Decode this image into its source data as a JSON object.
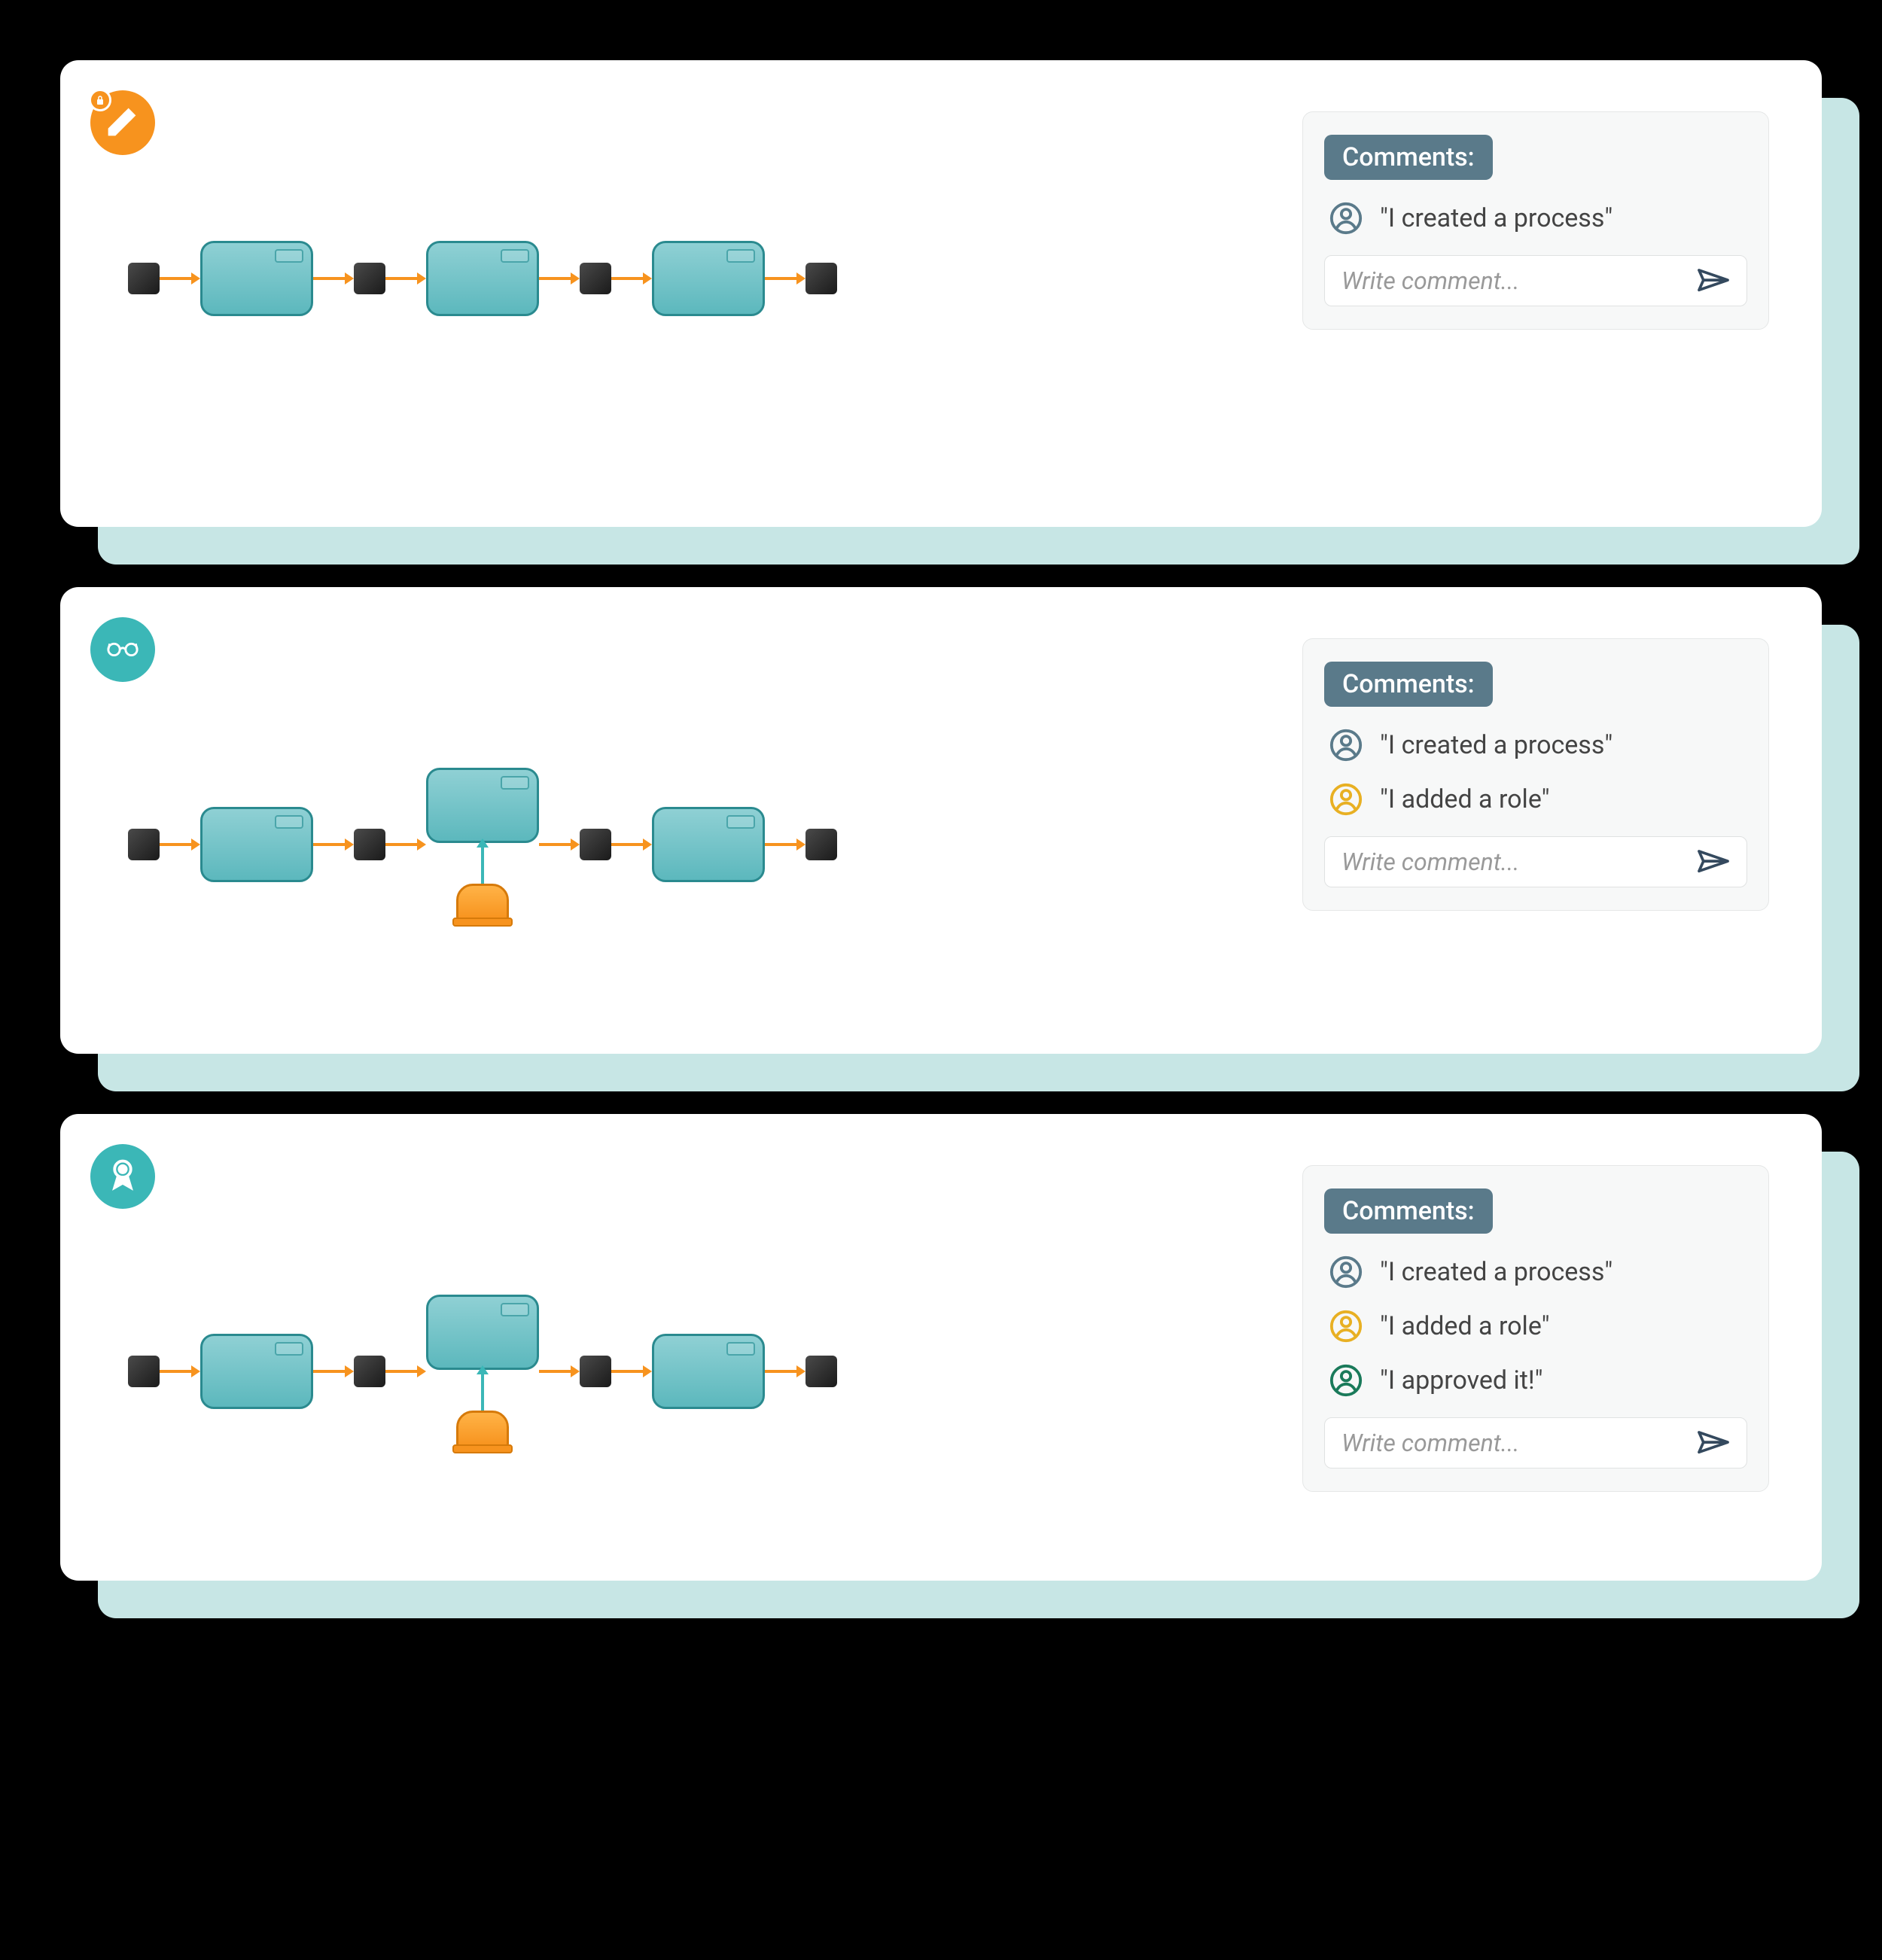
{
  "stages": [
    {
      "badge": {
        "color": "orange",
        "icon": "pencil",
        "lock": true
      },
      "flow": {
        "hasRole": false
      },
      "comments": {
        "header": "Comments:",
        "items": [
          {
            "avatarColor": "#5a7a8a",
            "text": "\"I created a process\""
          }
        ],
        "placeholder": "Write comment..."
      }
    },
    {
      "badge": {
        "color": "teal",
        "icon": "glasses",
        "lock": false
      },
      "flow": {
        "hasRole": true
      },
      "comments": {
        "header": "Comments:",
        "items": [
          {
            "avatarColor": "#5a7a8a",
            "text": "\"I created a process\""
          },
          {
            "avatarColor": "#e8b023",
            "text": "\"I added a role\""
          }
        ],
        "placeholder": "Write comment..."
      }
    },
    {
      "badge": {
        "color": "teal",
        "icon": "ribbon",
        "lock": false
      },
      "flow": {
        "hasRole": true
      },
      "comments": {
        "header": "Comments:",
        "items": [
          {
            "avatarColor": "#5a7a8a",
            "text": "\"I created a process\""
          },
          {
            "avatarColor": "#e8b023",
            "text": "\"I added a role\""
          },
          {
            "avatarColor": "#1a7a5a",
            "text": "\"I approved it!\""
          }
        ],
        "placeholder": "Write comment..."
      }
    }
  ]
}
